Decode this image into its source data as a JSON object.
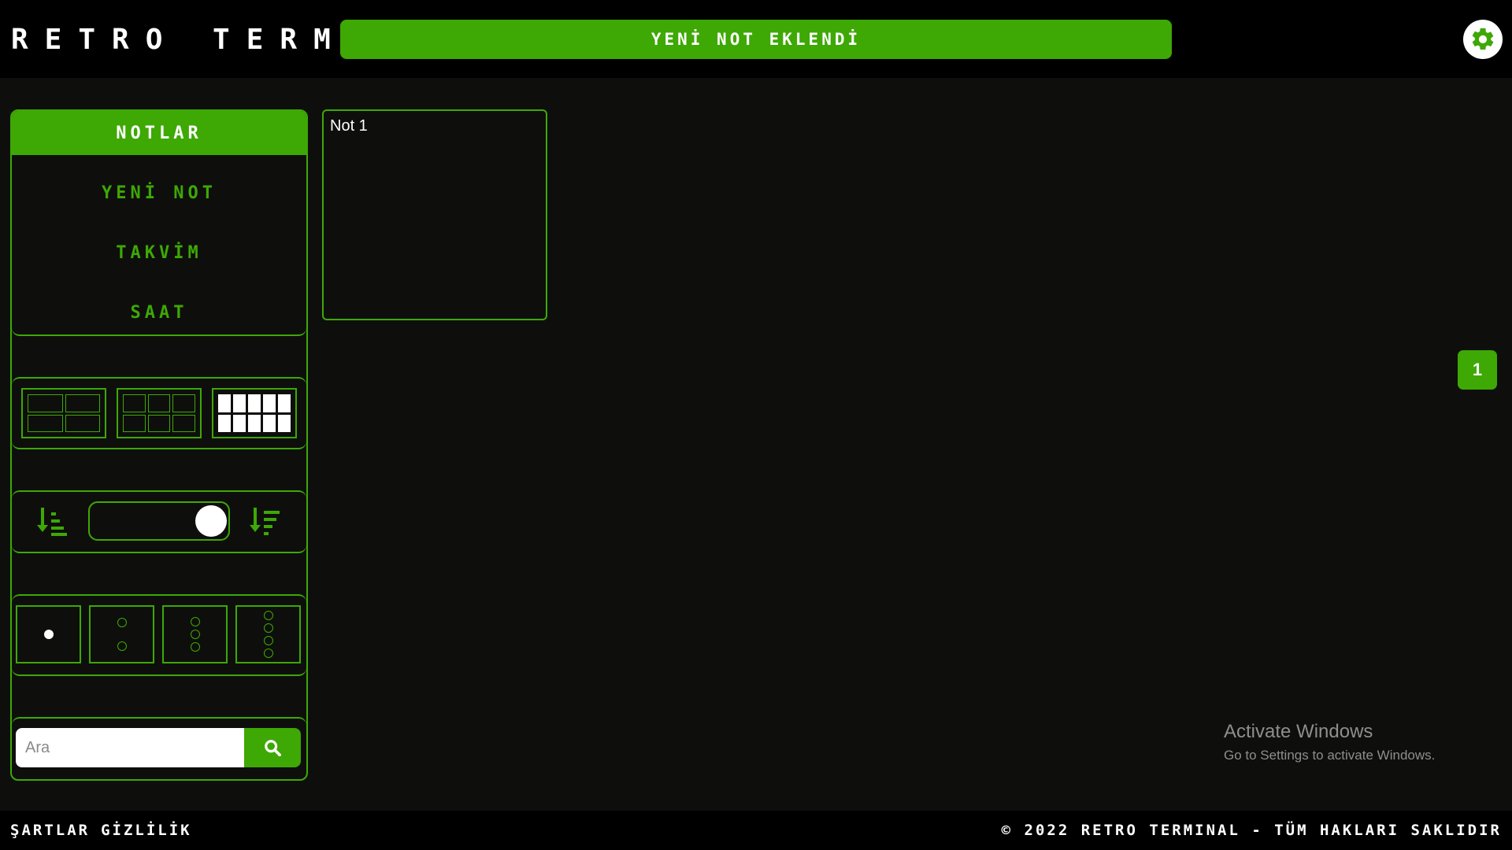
{
  "header": {
    "brand": "RETRO TERMINAL",
    "toast": "YENİ NOT EKLENDİ",
    "settings_icon": "gear-icon"
  },
  "sidebar": {
    "nav": [
      {
        "label": "NOTLAR",
        "active": true
      },
      {
        "label": "YENİ NOT",
        "active": false
      },
      {
        "label": "TAKVİM",
        "active": false
      },
      {
        "label": "SAAT",
        "active": false
      }
    ],
    "grid_sizes": [
      {
        "name": "grid-2x2",
        "cols": 2,
        "rows": 2,
        "active": false
      },
      {
        "name": "grid-3x2",
        "cols": 3,
        "rows": 2,
        "active": false
      },
      {
        "name": "grid-5x2",
        "cols": 5,
        "rows": 2,
        "active": true
      }
    ],
    "sort": {
      "ascending_icon": "sort-ascending-icon",
      "descending_icon": "sort-descending-icon",
      "toggle_state": "descending"
    },
    "columns": [
      {
        "dots": 1,
        "active": true
      },
      {
        "dots": 2,
        "active": false
      },
      {
        "dots": 3,
        "active": false
      },
      {
        "dots": 4,
        "active": false
      }
    ],
    "search": {
      "placeholder": "Ara",
      "value": "",
      "button_icon": "search-icon"
    }
  },
  "notes": [
    {
      "title": "Not 1"
    }
  ],
  "pagination": {
    "current_page": "1"
  },
  "watermark": {
    "title": "Activate Windows",
    "subtitle": "Go to Settings to activate Windows."
  },
  "footer": {
    "links": [
      "ŞARTLAR",
      "GİZLİLİK"
    ],
    "copyright": "© 2022 RETRO TERMINAL - TÜM HAKLARI SAKLIDIR"
  },
  "colors": {
    "accent": "#3ea805",
    "background": "#0e0f0d",
    "header_bg": "#000000"
  }
}
